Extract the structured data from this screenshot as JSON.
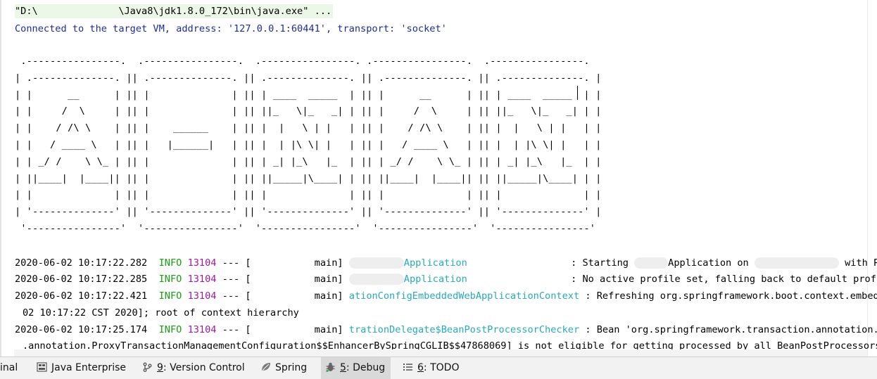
{
  "console": {
    "command_line": "\"D:\\              \\Java8\\jdk1.8.0_172\\bin\\java.exe\" ...",
    "connected_line": "Connected to the target VM, address: '127.0.0.1:60441', transport: 'socket'",
    "banner": [
      " .----------------.  .----------------.  .----------------. .----------------.  .----------------.",
      "| .--------------. || .--------------. || .--------------. || .--------------. || .--------------. |",
      "| |      __      | || |              | || | ____  _____  | || |      __      | || | ____  _____  | |",
      "| |     /  \\     | || |              | || ||_   \\|_   _| | || |     /  \\     | || ||_   \\|_   _| | |",
      "| |    / /\\ \\    | || |    ______    | || |  |   \\ | |   | || |    / /\\ \\    | || |  |   \\ | |   | |",
      "| |   / ____ \\   | || |   |______|   | || |  | |\\ \\| |   | || |   / ____ \\   | || |  | |\\ \\| |   | |",
      "| | _/ /    \\ \\_ | || |              | || | _| |_\\   |_  | || | _/ /    \\ \\_ | || | _| |_\\   |_  | |",
      "| ||____|  |____|| || |              | || ||_____|\\____| | || ||____|  |____|| || ||_____|\\____| | |",
      "| |              | || |              | || |              | || |              | || |              | |",
      "| '--------------' || '--------------' || '--------------' || '--------------' || '--------------' |",
      " '----------------'  '----------------'  '----------------'  '----------------'  '----------------'"
    ],
    "log_lines": [
      {
        "ts": "2020-06-02 10:17:22.282",
        "level": "INFO",
        "pid": "13104",
        "sep": "---",
        "thread": "main",
        "logger": "Application",
        "msg_pre": ": Starting",
        "msg_mid": "Application on",
        "msg_post": "with P"
      },
      {
        "ts": "2020-06-02 10:17:22.285",
        "level": "INFO",
        "pid": "13104",
        "sep": "---",
        "thread": "main",
        "logger": "Application",
        "msg": ": No active profile set, falling back to default profi"
      },
      {
        "ts": "2020-06-02 10:17:22.421",
        "level": "INFO",
        "pid": "13104",
        "sep": "---",
        "thread": "main",
        "logger": "ationConfigEmbeddedWebApplicationContext",
        "msg": ": Refreshing org.springframework.boot.context.embedded"
      },
      {
        "ts": "2020-06-02 10:17:25.174",
        "level": "INFO",
        "pid": "13104",
        "sep": "---",
        "thread": "main",
        "logger": "trationDelegate$BeanPostProcessorChecker",
        "msg": ": Bean 'org.springframework.transaction.annotation.Pro"
      }
    ],
    "wrap_line_1": "02 10:17:22 CST 2020]; root of context hierarchy",
    "wrap_line_2": ".annotation.ProxyTransactionManagementConfiguration$$EnhancerBySpringCGLIB$$47868069] is not eligible for getting processed by all BeanPostProcessors (f"
  },
  "status_bar": {
    "tabs": [
      {
        "label": "inal",
        "icon": "terminal-icon"
      },
      {
        "label": "Java Enterprise",
        "icon": "java-enterprise-icon"
      },
      {
        "num": "9",
        "label": ": Version Control",
        "icon": "version-control-icon"
      },
      {
        "label": "Spring",
        "icon": "spring-leaf-icon"
      },
      {
        "num": "5",
        "label": ": Debug",
        "icon": "debug-bug-icon",
        "active": true
      },
      {
        "num": "6",
        "label": ": TODO",
        "icon": "todo-list-icon"
      }
    ]
  },
  "colors": {
    "info": "#16a112",
    "pid": "#a0199f",
    "logger": "#27a9b9",
    "connected": "#1e2b9e",
    "command_bg": "#edf7e8"
  }
}
